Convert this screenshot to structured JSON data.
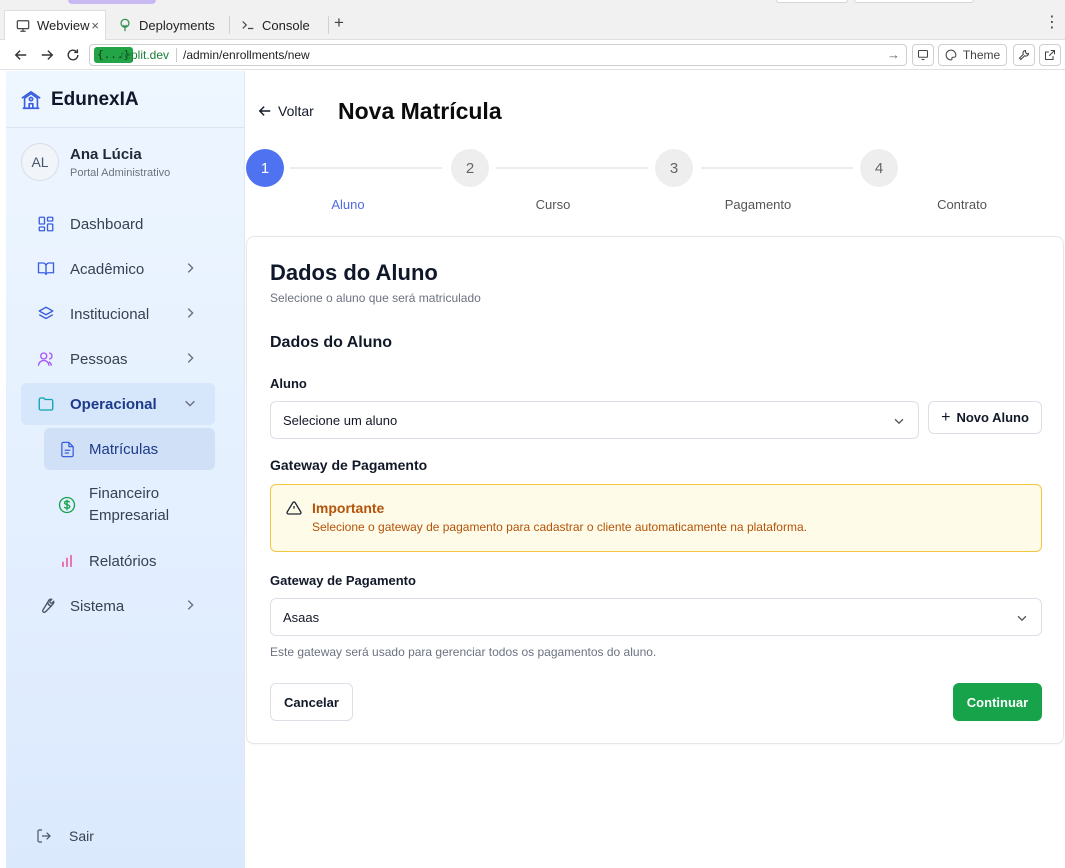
{
  "browser": {
    "tabs": [
      {
        "label": "Webview",
        "icon": "monitor-icon"
      },
      {
        "label": "Deployments",
        "icon": "deploy-tree-icon"
      },
      {
        "label": "Console",
        "icon": "terminal-icon"
      }
    ],
    "close_glyph": "×",
    "new_tab": "+",
    "menu": "⋮",
    "url_badge": "{...}",
    "url_domain": ".replit.dev",
    "url_path": "/admin/enrollments/new",
    "theme_label": "Theme"
  },
  "sidebar": {
    "brand": "EdunexIA",
    "user": {
      "initials": "AL",
      "name": "Ana Lúcia",
      "role": "Portal Administrativo"
    },
    "items": [
      {
        "label": "Dashboard",
        "icon": "dashboard-icon"
      },
      {
        "label": "Acadêmico",
        "icon": "book-open-icon"
      },
      {
        "label": "Institucional",
        "icon": "layers-icon"
      },
      {
        "label": "Pessoas",
        "icon": "users-icon"
      },
      {
        "label": "Operacional",
        "icon": "folder-icon"
      },
      {
        "label": "Sistema",
        "icon": "wrench-icon"
      }
    ],
    "subitems": [
      {
        "label": "Matrículas",
        "icon": "file-text-icon"
      },
      {
        "label": "Financeiro Empresarial",
        "icon": "dollar-circle-icon"
      },
      {
        "label": "Relatórios",
        "icon": "bar-chart-icon"
      }
    ],
    "logout": "Sair",
    "colors": {
      "accent": "#3b5fe0",
      "active_bg": "#cfe0f7"
    }
  },
  "main": {
    "back": "Voltar",
    "title": "Nova Matrícula",
    "steps": [
      {
        "number": "1",
        "label": "Aluno",
        "state": "current"
      },
      {
        "number": "2",
        "label": "Curso",
        "state": "upcoming"
      },
      {
        "number": "3",
        "label": "Pagamento",
        "state": "upcoming"
      },
      {
        "number": "4",
        "label": "Contrato",
        "state": "upcoming"
      }
    ],
    "card": {
      "title": "Dados do Aluno",
      "subtitle": "Selecione o aluno que será matriculado",
      "section_title": "Dados do Aluno",
      "student_label": "Aluno",
      "student_placeholder": "Selecione um aluno",
      "new_student": "Novo Aluno",
      "gateway_section": "Gateway de Pagamento",
      "alert_title": "Importante",
      "alert_text": "Selecione o gateway de pagamento para cadastrar o cliente automaticamente na plataforma.",
      "gateway_label": "Gateway de Pagamento",
      "gateway_value": "Asaas",
      "gateway_help": "Este gateway será usado para gerenciar todos os pagamentos do aluno.",
      "cancel": "Cancelar",
      "continue": "Continuar"
    },
    "colors": {
      "primary_step": "#4f72f0",
      "continue_btn": "#16a34a",
      "alert_border": "#f5c542",
      "alert_text": "#b45309"
    }
  }
}
